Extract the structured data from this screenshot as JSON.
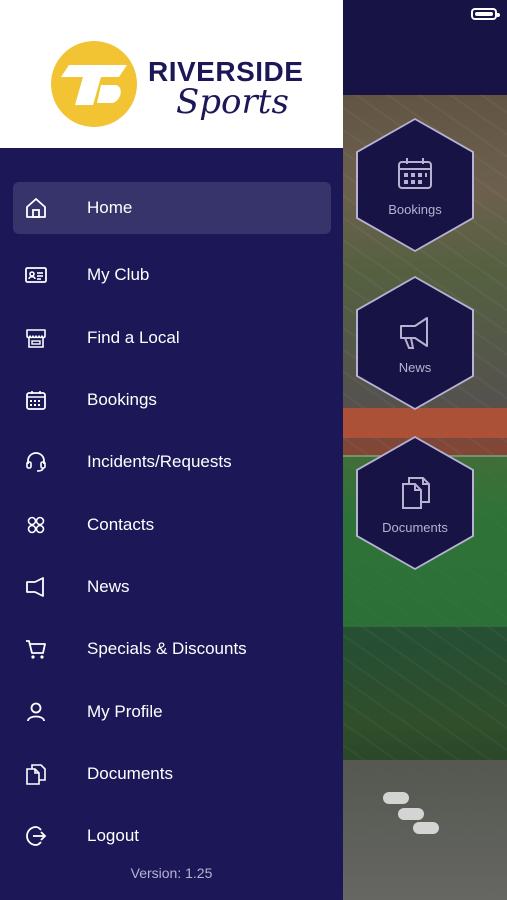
{
  "brand": {
    "line1": "RIVERSIDE",
    "line2": "Sports",
    "accent_color": "#f2c433",
    "drawer_color": "#1c1858"
  },
  "menu": [
    {
      "label": "Home",
      "icon": "home-icon",
      "active": true
    },
    {
      "label": "My Club",
      "icon": "id-card-icon",
      "active": false
    },
    {
      "label": "Find a Local",
      "icon": "store-icon",
      "active": false
    },
    {
      "label": "Bookings",
      "icon": "calendar-icon",
      "active": false
    },
    {
      "label": "Incidents/Requests",
      "icon": "headset-icon",
      "active": false
    },
    {
      "label": "Contacts",
      "icon": "contacts-icon",
      "active": false
    },
    {
      "label": "News",
      "icon": "megaphone-icon",
      "active": false
    },
    {
      "label": "Specials & Discounts",
      "icon": "cart-icon",
      "active": false
    },
    {
      "label": "My Profile",
      "icon": "user-icon",
      "active": false
    },
    {
      "label": "Documents",
      "icon": "documents-icon",
      "active": false
    },
    {
      "label": "Logout",
      "icon": "logout-icon",
      "active": false
    }
  ],
  "version": "Version: 1.25",
  "tiles": [
    {
      "label": "Bookings",
      "icon": "calendar-icon"
    },
    {
      "label": "News",
      "icon": "megaphone-icon"
    },
    {
      "label": "Documents",
      "icon": "documents-icon"
    }
  ]
}
